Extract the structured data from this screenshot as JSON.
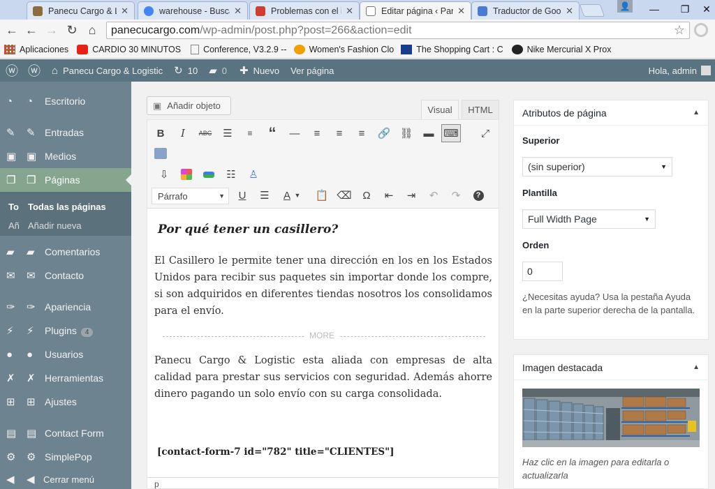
{
  "browser": {
    "tabs": [
      {
        "title": "Panecu Cargo & Lo",
        "color": "#8a6d3b"
      },
      {
        "title": "warehouse - Buscar",
        "color": "#4285f4"
      },
      {
        "title": "Problemas con el in",
        "color": "#d23c2f"
      },
      {
        "title": "Editar página ‹ Pane",
        "color": "#777777"
      },
      {
        "title": "Traductor de Googl",
        "color": "#4a7ad6"
      }
    ],
    "window_controls": {
      "minimize": "—",
      "restore": "❐",
      "close": "✕"
    },
    "url_host": "panecucargo.com",
    "url_path": "/wp-admin/post.php?post=266&action=edit",
    "bookmarks": [
      {
        "label": "Aplicaciones",
        "color": "#e34234"
      },
      {
        "label": "CARDIO 30 MINUTOS",
        "color": "#e62117"
      },
      {
        "label": "Conference, V3.2.9 --",
        "color": "#888888"
      },
      {
        "label": "Women's Fashion Clo",
        "color": "#f0a000"
      },
      {
        "label": "The Shopping Cart : C",
        "color": "#1a3c8c"
      },
      {
        "label": "Nike Mercurial X Prox",
        "color": "#222222"
      }
    ]
  },
  "adminbar": {
    "site_name": "Panecu Cargo & Logistic",
    "updates_count": "10",
    "comments_count": "0",
    "new_label": "Nuevo",
    "view_page": "Ver página",
    "greeting": "Hola, admin"
  },
  "sidebar": {
    "items": [
      {
        "label": "Escritorio",
        "icon": "dashboard-icon"
      },
      {
        "label": "Entradas",
        "icon": "pin-icon"
      },
      {
        "label": "Medios",
        "icon": "media-icon"
      },
      {
        "label": "Páginas",
        "icon": "pages-icon"
      },
      {
        "label": "Comentarios",
        "icon": "comments-icon"
      },
      {
        "label": "Contacto",
        "icon": "mail-icon"
      },
      {
        "label": "Apariencia",
        "icon": "brush-icon"
      },
      {
        "label": "Plugins",
        "icon": "plugin-icon",
        "badge": "4"
      },
      {
        "label": "Usuarios",
        "icon": "users-icon"
      },
      {
        "label": "Herramientas",
        "icon": "wrench-icon"
      },
      {
        "label": "Ajustes",
        "icon": "settings-icon"
      },
      {
        "label": "Contact Form",
        "icon": "form-icon"
      },
      {
        "label": "SimplePop",
        "icon": "gear-icon"
      },
      {
        "label": "Cerrar menú",
        "icon": "collapse-icon"
      }
    ],
    "submenu": [
      {
        "prefix": "To",
        "label": "Todas las páginas"
      },
      {
        "prefix": "Añ",
        "label": "Añadir nueva"
      }
    ]
  },
  "editor": {
    "add_media": "Añadir objeto",
    "tab_visual": "Visual",
    "tab_html": "HTML",
    "format_select": "Párrafo",
    "heading": "Por qué tener un casillero?",
    "paragraph1": " El Casillero le permite tener una dirección en los en los Estados Unidos para recibir sus paquetes sin importar donde los compre, si son adquiridos en diferentes tiendas nosotros los consolidamos para el envío.",
    "more": "MORE",
    "paragraph2": "Panecu Cargo & Logistic esta aliada con empresas de alta calidad para prestar sus servicios con seguridad. Además ahorre dinero pagando un solo envío con su carga consolidada.",
    "shortcode": "[contact-form-7 id=\"782\" title=\"CLIENTES\"]",
    "path": "p"
  },
  "page_attributes": {
    "title": "Atributos de página",
    "parent_label": "Superior",
    "parent_value": "(sin superior)",
    "template_label": "Plantilla",
    "template_value": "Full Width Page",
    "order_label": "Orden",
    "order_value": "0",
    "help": "¿Necesitas ayuda? Usa la pestaña Ayuda en la parte superior derecha de la pantalla."
  },
  "featured_image": {
    "title": "Imagen destacada",
    "caption": "Haz clic en la imagen para editarla o actualizarla"
  }
}
